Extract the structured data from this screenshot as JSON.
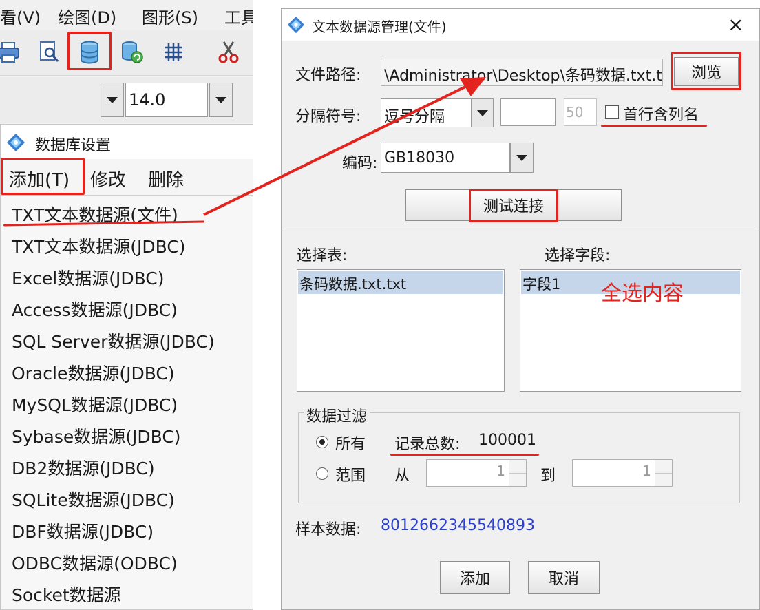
{
  "app": {
    "menu": [
      "看(V)",
      "绘图(D)",
      "图形(S)",
      "工具"
    ],
    "font_size": "14.0"
  },
  "db_settings": {
    "title": "数据库设置",
    "menu": {
      "add": "添加(T)",
      "edit": "修改",
      "delete": "删除"
    },
    "sources": [
      "TXT文本数据源(文件)",
      "TXT文本数据源(JDBC)",
      "Excel数据源(JDBC)",
      "Access数据源(JDBC)",
      "SQL Server数据源(JDBC)",
      "Oracle数据源(JDBC)",
      "MySQL数据源(JDBC)",
      "Sybase数据源(JDBC)",
      "DB2数据源(JDBC)",
      "SQLite数据源(JDBC)",
      "DBF数据源(JDBC)",
      "ODBC数据源(ODBC)",
      "Socket数据源"
    ]
  },
  "dialog": {
    "title": "文本数据源管理(文件)",
    "close": "×",
    "file_path_label": "文件路径:",
    "file_path_value": "\\Administrator\\Desktop\\条码数据.txt.txt",
    "browse": "浏览",
    "separator_label": "分隔符号:",
    "separator_value": "逗号分隔",
    "separator_length": "50",
    "header_checkbox": "首行含列名",
    "encoding_label": "编码:",
    "encoding_value": "GB18030",
    "test_connection": "测试连接",
    "select_table_label": "选择表:",
    "tables": [
      "条码数据.txt.txt"
    ],
    "select_field_label": "选择字段:",
    "fields": [
      "字段1"
    ],
    "annotation": "全选内容",
    "filter_group": "数据过滤",
    "filter_all": "所有",
    "record_count_label": "记录总数:",
    "record_count": "100001",
    "filter_range": "范围",
    "from_label": "从",
    "from_value": "1",
    "to_label": "到",
    "to_value": "1",
    "sample_label": "样本数据:",
    "sample_value": "8012662345540893",
    "add": "添加",
    "cancel": "取消"
  },
  "colors": {
    "annotation_red": "#e3231e",
    "selection": "#c6d6ea",
    "sample_blue": "#2a3fd0"
  }
}
